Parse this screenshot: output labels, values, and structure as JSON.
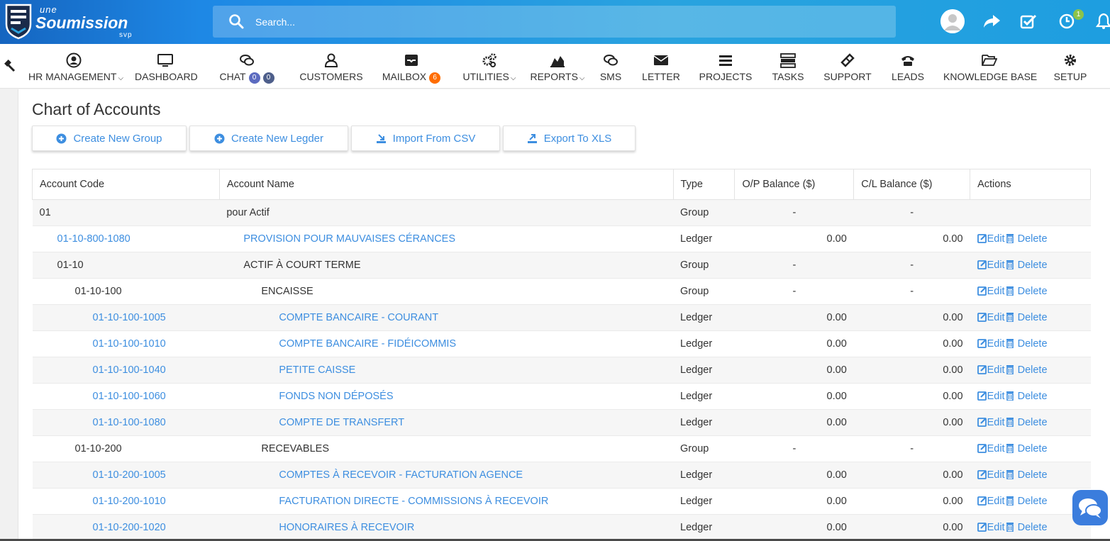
{
  "brand": {
    "line1": "une",
    "line2": "Soumission",
    "line3": "svp"
  },
  "search": {
    "placeholder": "Search..."
  },
  "topbar": {
    "notification_count": "1"
  },
  "nav": [
    {
      "label": "HR MANAGEMENT",
      "icon": "user-circle-icon",
      "dropdown": true
    },
    {
      "label": "DASHBOARD",
      "icon": "monitor-icon"
    },
    {
      "label": "CHAT",
      "icon": "chat-icon",
      "badges": [
        "0",
        "0"
      ]
    },
    {
      "label": "CUSTOMERS",
      "icon": "user-icon"
    },
    {
      "label": "MAILBOX",
      "icon": "inbox-icon",
      "badges": [
        "6"
      ]
    },
    {
      "label": "UTILITIES",
      "icon": "gears-icon",
      "dropdown": true
    },
    {
      "label": "REPORTS",
      "icon": "area-chart-icon",
      "dropdown": true
    },
    {
      "label": "SMS",
      "icon": "sms-icon"
    },
    {
      "label": "LETTER",
      "icon": "envelope-icon"
    },
    {
      "label": "PROJECTS",
      "icon": "list-icon"
    },
    {
      "label": "TASKS",
      "icon": "tasks-icon"
    },
    {
      "label": "SUPPORT",
      "icon": "ticket-icon"
    },
    {
      "label": "LEADS",
      "icon": "phone-icon"
    },
    {
      "label": "KNOWLEDGE BASE",
      "icon": "folder-open-icon"
    },
    {
      "label": "SETUP",
      "icon": "cog-icon"
    }
  ],
  "page": {
    "title": "Chart of Accounts",
    "buttons": {
      "create_group": "Create New Group",
      "create_ledger": "Create New Legder",
      "import_csv": "Import From CSV",
      "export_xls": "Export To XLS"
    }
  },
  "table": {
    "headers": [
      "Account Code",
      "Account Name",
      "Type",
      "O/P Balance ($)",
      "C/L Balance ($)",
      "Actions"
    ],
    "edit_label": "Edit",
    "delete_label": "Delete",
    "rows": [
      {
        "code": "01",
        "name": "pour Actif",
        "type": "Group",
        "op": "-",
        "cl": "-",
        "level": 0,
        "ledger": false,
        "actions": false
      },
      {
        "code": "01-10-800-1080",
        "name": "PROVISION POUR MAUVAISES CÉRANCES",
        "type": "Ledger",
        "op": "0.00",
        "cl": "0.00",
        "level": 1,
        "ledger": true,
        "actions": true
      },
      {
        "code": "01-10",
        "name": "ACTIF À COURT TERME",
        "type": "Group",
        "op": "-",
        "cl": "-",
        "level": 1,
        "ledger": false,
        "actions": true
      },
      {
        "code": "01-10-100",
        "name": "ENCAISSE",
        "type": "Group",
        "op": "-",
        "cl": "-",
        "level": 2,
        "ledger": false,
        "actions": true
      },
      {
        "code": "01-10-100-1005",
        "name": "COMPTE BANCAIRE - COURANT",
        "type": "Ledger",
        "op": "0.00",
        "cl": "0.00",
        "level": 3,
        "ledger": true,
        "actions": true
      },
      {
        "code": "01-10-100-1010",
        "name": "COMPTE BANCAIRE - FIDÉICOMMIS",
        "type": "Ledger",
        "op": "0.00",
        "cl": "0.00",
        "level": 3,
        "ledger": true,
        "actions": true
      },
      {
        "code": "01-10-100-1040",
        "name": "PETITE CAISSE",
        "type": "Ledger",
        "op": "0.00",
        "cl": "0.00",
        "level": 3,
        "ledger": true,
        "actions": true
      },
      {
        "code": "01-10-100-1060",
        "name": "FONDS NON DÉPOSÉS",
        "type": "Ledger",
        "op": "0.00",
        "cl": "0.00",
        "level": 3,
        "ledger": true,
        "actions": true
      },
      {
        "code": "01-10-100-1080",
        "name": "COMPTE DE TRANSFERT",
        "type": "Ledger",
        "op": "0.00",
        "cl": "0.00",
        "level": 3,
        "ledger": true,
        "actions": true
      },
      {
        "code": "01-10-200",
        "name": "RECEVABLES",
        "type": "Group",
        "op": "-",
        "cl": "-",
        "level": 2,
        "ledger": false,
        "actions": true
      },
      {
        "code": "01-10-200-1005",
        "name": "COMPTES À RECEVOIR - FACTURATION AGENCE",
        "type": "Ledger",
        "op": "0.00",
        "cl": "0.00",
        "level": 3,
        "ledger": true,
        "actions": true
      },
      {
        "code": "01-10-200-1010",
        "name": "FACTURATION DIRECTE - COMMISSIONS À RECEVOIR",
        "type": "Ledger",
        "op": "0.00",
        "cl": "0.00",
        "level": 3,
        "ledger": true,
        "actions": true
      },
      {
        "code": "01-10-200-1020",
        "name": "HONORAIRES À RECEVOIR",
        "type": "Ledger",
        "op": "0.00",
        "cl": "0.00",
        "level": 3,
        "ledger": true,
        "actions": true
      }
    ]
  },
  "colors": {
    "accent": "#3d8ee0",
    "topbar": "#1e88e5",
    "badge_orange": "#ff6d00",
    "badge_blue": "#5c6bc0"
  }
}
